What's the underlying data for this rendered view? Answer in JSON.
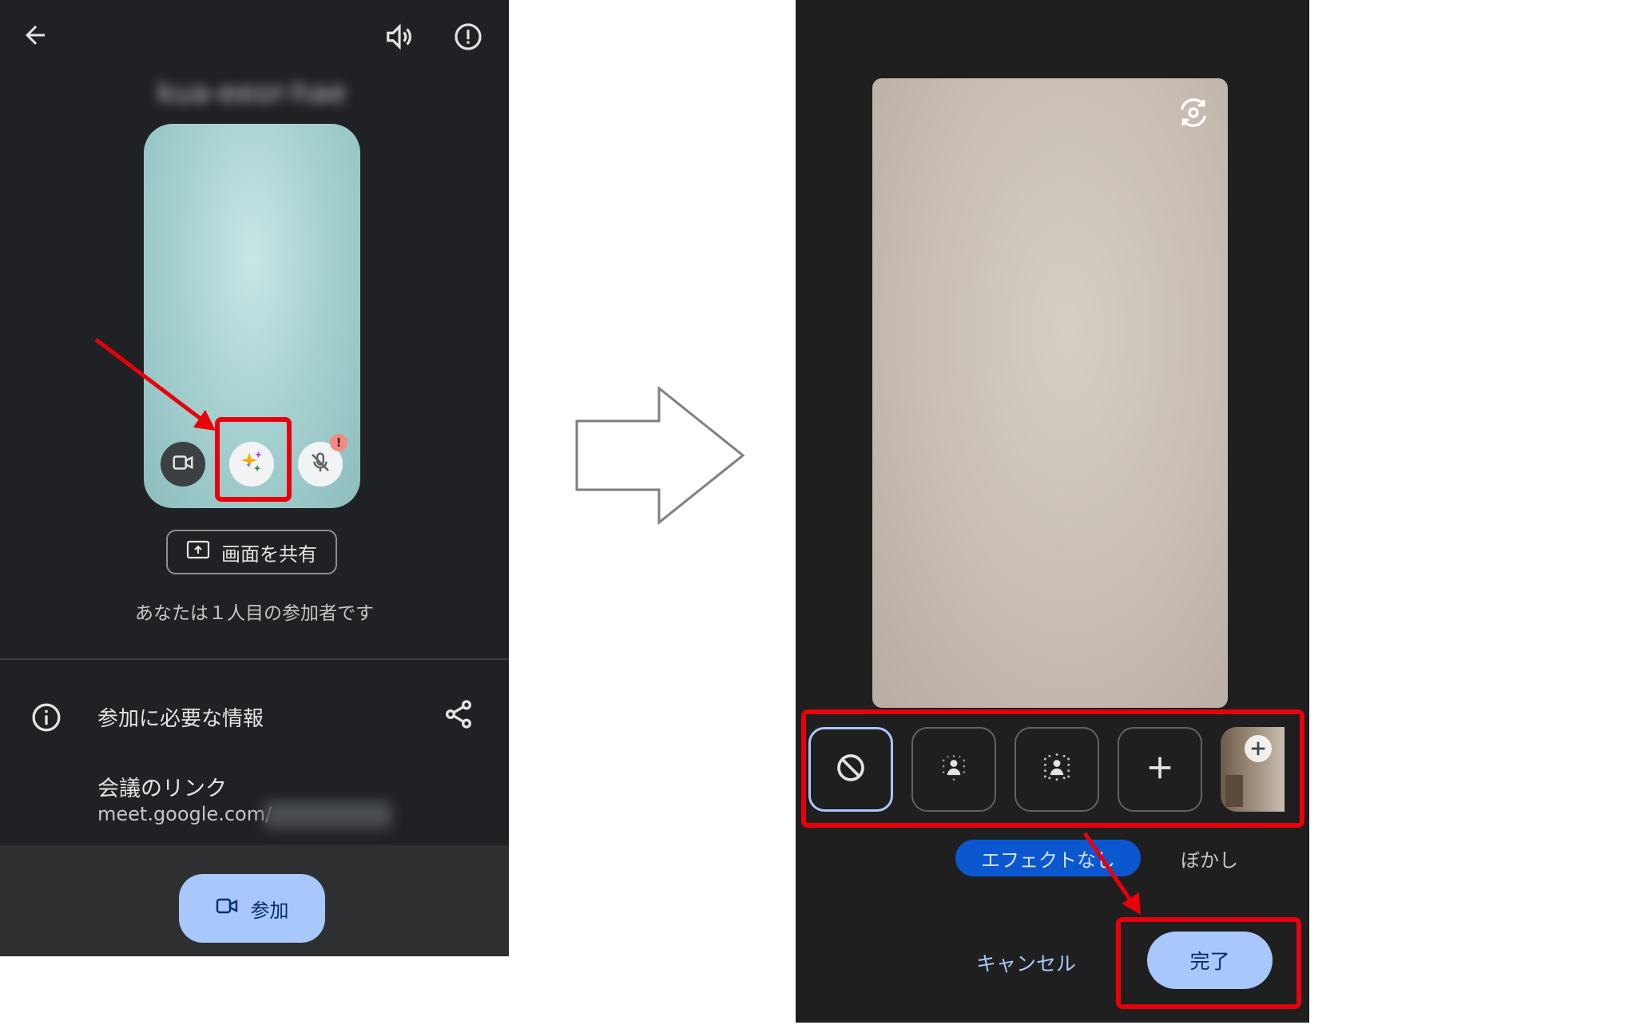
{
  "left_screen": {
    "meeting_code": "kua-eeor-hae",
    "share_label": "画面を共有",
    "participant_text": "あなたは１人目の参加者です",
    "info_title": "参加に必要な情報",
    "link_title": "会議のリンク",
    "link_url": "meet.google.com/",
    "join_label": "参加"
  },
  "right_screen": {
    "effect_labels": {
      "no_effect": "エフェクトなし",
      "blur": "ぼかし"
    },
    "cancel_label": "キャンセル",
    "done_label": "完了"
  },
  "colors": {
    "highlight_red": "#e8000b",
    "accent_blue": "#a8c7fa",
    "selected_chip": "#0b57d0"
  },
  "icons": [
    "back-arrow-icon",
    "speaker-icon",
    "alert-icon",
    "camera-icon",
    "effects-sparkle-icon",
    "mic-off-icon",
    "present-icon",
    "info-icon",
    "share-icon",
    "video-icon",
    "switch-camera-icon",
    "no-effect-icon",
    "blur-slight-icon",
    "blur-full-icon",
    "plus-icon"
  ]
}
